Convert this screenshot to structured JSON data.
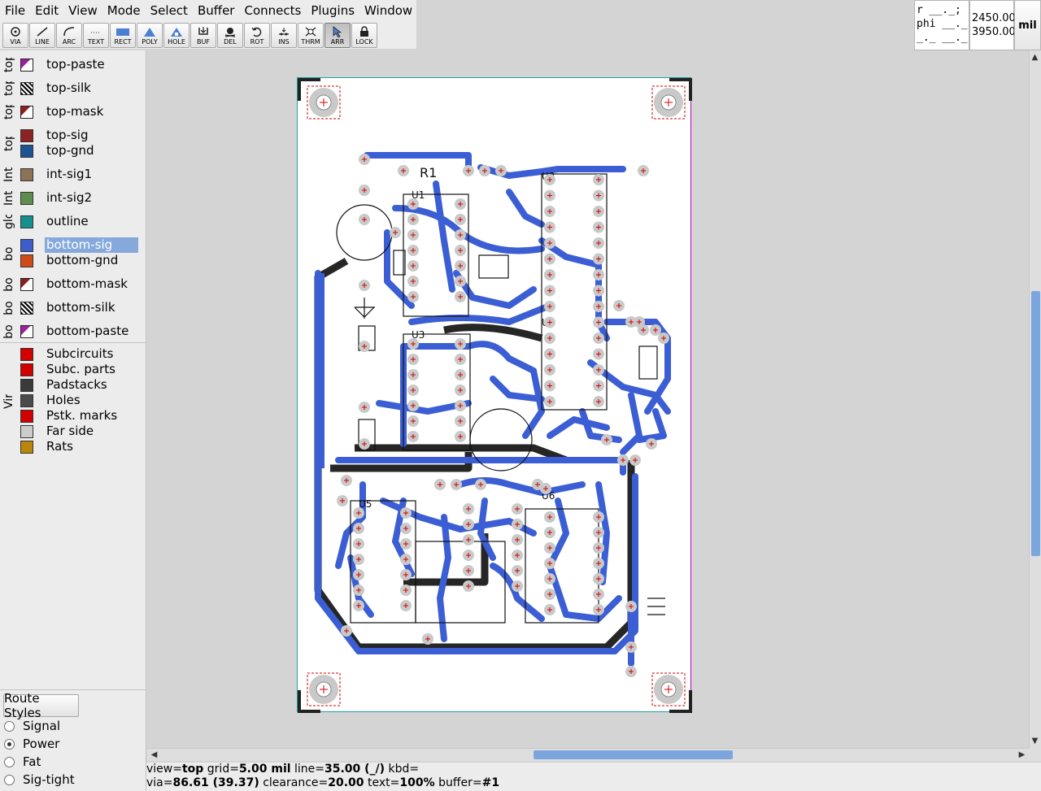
{
  "menu": [
    "File",
    "Edit",
    "View",
    "Mode",
    "Select",
    "Buffer",
    "Connects",
    "Plugins",
    "Window"
  ],
  "tools": [
    {
      "label": "VIA",
      "icon": "via-icon"
    },
    {
      "label": "LINE",
      "icon": "line-icon"
    },
    {
      "label": "ARC",
      "icon": "arc-icon"
    },
    {
      "label": "TEXT",
      "icon": "text-icon"
    },
    {
      "label": "RECT",
      "icon": "rect-icon"
    },
    {
      "label": "POLY",
      "icon": "poly-icon"
    },
    {
      "label": "HOLE",
      "icon": "hole-icon"
    },
    {
      "label": "BUF",
      "icon": "buffer-icon"
    },
    {
      "label": "DEL",
      "icon": "delete-icon"
    },
    {
      "label": "ROT",
      "icon": "rotate-icon"
    },
    {
      "label": "INS",
      "icon": "insert-icon"
    },
    {
      "label": "THRM",
      "icon": "thermal-icon"
    },
    {
      "label": "ARR",
      "icon": "arrow-icon",
      "active": true
    },
    {
      "label": "LOCK",
      "icon": "lock-icon"
    }
  ],
  "crosshair": {
    "line1": "r __._;",
    "line2": "phi __._;",
    "line3": "_._ __._"
  },
  "coords": {
    "x": "2450.00",
    "y": "3950.00"
  },
  "units": "mil",
  "layer_groups": [
    {
      "label": "top",
      "layers": [
        {
          "name": "top-paste",
          "color": "#9e1fa0",
          "style": "outline"
        }
      ]
    },
    {
      "label": "top",
      "layers": [
        {
          "name": "top-silk",
          "color": "#000000",
          "style": "hatch"
        }
      ]
    },
    {
      "label": "top",
      "layers": [
        {
          "name": "top-mask",
          "color": "#8b2020",
          "style": "outline"
        }
      ]
    },
    {
      "label": "top c",
      "layers": [
        {
          "name": "top-sig",
          "color": "#8b2224",
          "style": "fill"
        },
        {
          "name": "top-gnd",
          "color": "#1d5593",
          "style": "fill"
        }
      ]
    },
    {
      "label": "Int",
      "layers": [
        {
          "name": "int-sig1",
          "color": "#8c7355",
          "style": "fill"
        }
      ]
    },
    {
      "label": "Int",
      "layers": [
        {
          "name": "int-sig2",
          "color": "#5e8e4f",
          "style": "fill"
        }
      ]
    },
    {
      "label": "glo",
      "layers": [
        {
          "name": "outline",
          "color": "#16908d",
          "style": "fill"
        }
      ]
    },
    {
      "label": "botto",
      "layers": [
        {
          "name": "bottom-sig",
          "color": "#3d5dcc",
          "style": "fill",
          "selected": true
        },
        {
          "name": "bottom-gnd",
          "color": "#cf4b16",
          "style": "fill"
        }
      ]
    },
    {
      "label": "bo",
      "layers": [
        {
          "name": "bottom-mask",
          "color": "#8b2020",
          "style": "outline"
        }
      ]
    },
    {
      "label": "bo",
      "layers": [
        {
          "name": "bottom-silk",
          "color": "#000000",
          "style": "hatch"
        }
      ]
    },
    {
      "label": "bo",
      "layers": [
        {
          "name": "bottom-paste",
          "color": "#9e1fa0",
          "style": "outline"
        }
      ]
    }
  ],
  "virtual": {
    "label": "Virtual",
    "layers": [
      {
        "name": "Subcircuits",
        "color": "#d40000"
      },
      {
        "name": "Subc. parts",
        "color": "#d40000"
      },
      {
        "name": "Padstacks",
        "color": "#3a3a3a"
      },
      {
        "name": "Holes",
        "color": "#4a4a4a"
      },
      {
        "name": "Pstk. marks",
        "color": "#d40000"
      },
      {
        "name": "Far side",
        "color": "#cccccc"
      },
      {
        "name": "Rats",
        "color": "#b8860b"
      }
    ]
  },
  "route_styles": {
    "button": "Route Styles",
    "items": [
      {
        "label": "Signal",
        "selected": false
      },
      {
        "label": "Power",
        "selected": true
      },
      {
        "label": "Fat",
        "selected": false
      },
      {
        "label": "Sig-tight",
        "selected": false
      }
    ]
  },
  "status": {
    "line1": {
      "view_k": "view",
      "view_v": "top",
      "grid_k": "grid",
      "grid_v": "5.00 mil",
      "line_k": "line",
      "line_v": "35.00 (_/)",
      "kbd_k": "kbd",
      "kbd_v": ""
    },
    "line2": {
      "via_k": "via",
      "via_v": "86.61 (39.37)",
      "clr_k": "clearance",
      "clr_v": "20.00",
      "text_k": "text",
      "text_v": "100%",
      "buf_k": "buffer",
      "buf_v": "#1"
    }
  },
  "board": {
    "silk_labels": [
      "R1",
      "U1",
      "U2",
      "U3",
      "U4",
      "U5",
      "U6"
    ]
  }
}
